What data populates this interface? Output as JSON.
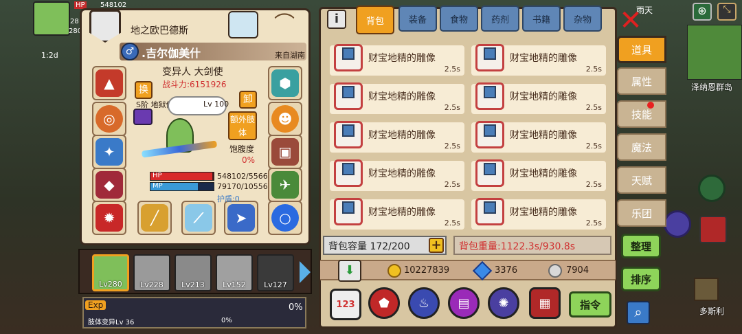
{
  "hud": {
    "hp_label": "HP",
    "mp_label": "MP",
    "hp_value": "548102",
    "time_label": "1:2d",
    "side_nums": [
      "28",
      "280"
    ],
    "top_right": "雨天"
  },
  "char": {
    "location": "地之欧巴德斯",
    "name": ".吉尔伽美什",
    "origin": "来自湖南",
    "class": "变异人 大剑使",
    "power": "战斗力:6151926",
    "swap_btn": "换",
    "unequip_btn": "卸",
    "pet_label": "S阶 地狱使",
    "pet_level": "Lv 100",
    "extra_limb_btn": "额外肢体",
    "satiety_label": "饱腹度",
    "satiety_value": "0%",
    "hp_label": "HP",
    "mp_label": "MP",
    "hp_value": "548102/5566",
    "mp_value": "79170/10556",
    "shield": "护盾:0",
    "hp_frac": 0.98,
    "mp_frac": 0.75
  },
  "team": [
    {
      "level": "Lv280"
    },
    {
      "level": "Lv228"
    },
    {
      "level": "Lv213"
    },
    {
      "level": "Lv152"
    },
    {
      "level": "Lv127"
    }
  ],
  "exp": {
    "label": "Exp",
    "value": "0%",
    "limb_label": "肢体变异Lv 36",
    "limb_value": "0%"
  },
  "tabs": [
    "背包",
    "装备",
    "食物",
    "药剂",
    "书籍",
    "杂物"
  ],
  "items": [
    {
      "name": "财宝地精的雕像",
      "time": "2.5s"
    },
    {
      "name": "财宝地精的雕像",
      "time": "2.5s"
    },
    {
      "name": "财宝地精的雕像",
      "time": "2.5s"
    },
    {
      "name": "财宝地精的雕像",
      "time": "2.5s"
    },
    {
      "name": "财宝地精的雕像",
      "time": "2.5s"
    },
    {
      "name": "财宝地精的雕像",
      "time": "2.5s"
    },
    {
      "name": "财宝地精的雕像",
      "time": "2.5s"
    },
    {
      "name": "财宝地精的雕像",
      "time": "2.5s"
    },
    {
      "name": "财宝地精的雕像",
      "time": "2.5s"
    },
    {
      "name": "财宝地精的雕像",
      "time": "2.5s"
    }
  ],
  "bag": {
    "capacity": "背包容量 172/200",
    "weight": "背包重量:1122.3s/930.8s"
  },
  "currency": {
    "gold": "10227839",
    "diamond": "3376",
    "silver": "7904"
  },
  "bottom": {
    "num_icon": "123",
    "command_btn": "指令"
  },
  "side_tabs": [
    "道具",
    "属性",
    "技能",
    "魔法",
    "天赋",
    "乐团"
  ],
  "actions": {
    "organize": "整理",
    "sort": "排序"
  },
  "map": {
    "island": "泽纳恩群岛",
    "town": "多斯利"
  },
  "colors": {
    "parchment": "#f0e2c4",
    "tab_blue": "#5f86b6",
    "tab_active": "#f0a020",
    "accent_red": "#d03030",
    "green_btn": "#8ed45a"
  }
}
